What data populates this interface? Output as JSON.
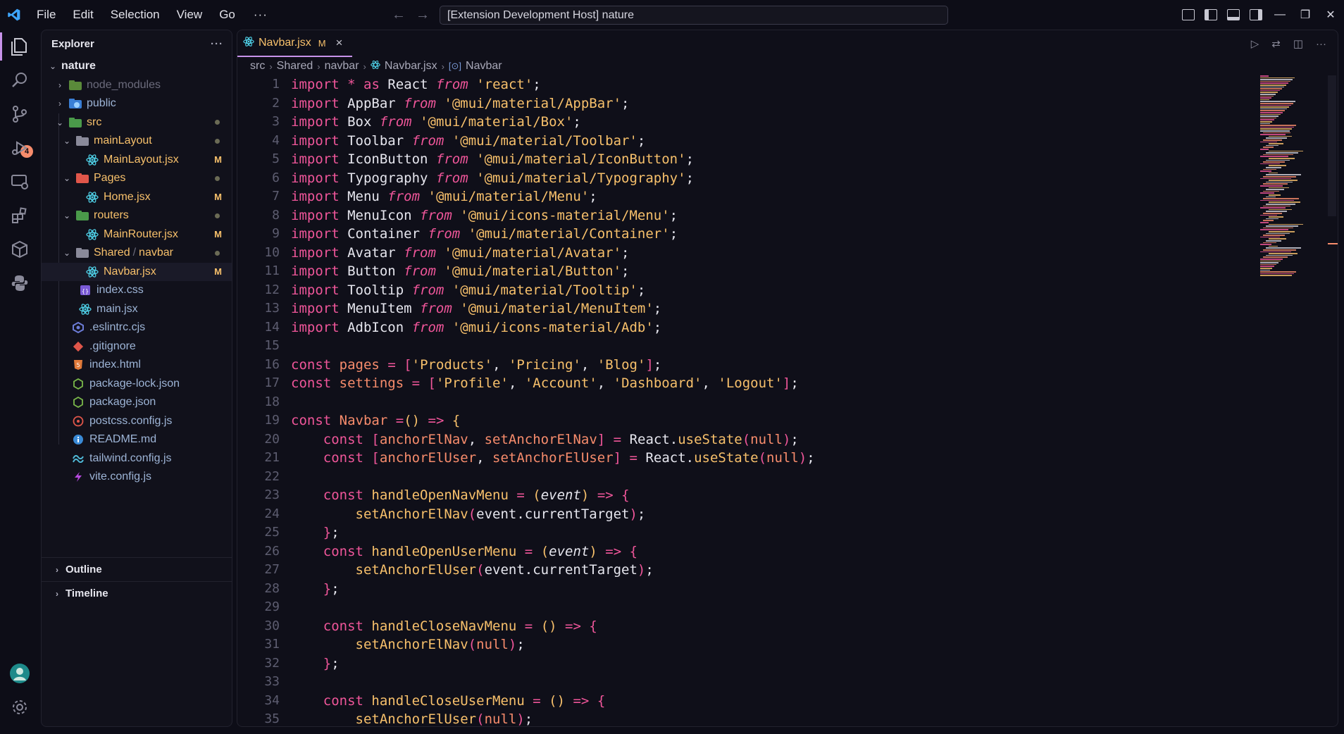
{
  "titlebar": {
    "menus": [
      "File",
      "Edit",
      "Selection",
      "View",
      "Go"
    ],
    "more": "···",
    "command_center": "[Extension Development Host] nature"
  },
  "activity": {
    "source_control_badge": "4"
  },
  "explorer": {
    "title": "Explorer",
    "more": "···",
    "root": "nature",
    "items": [
      {
        "label": "node_modules",
        "decoration": ""
      },
      {
        "label": "public",
        "decoration": ""
      },
      {
        "label": "src",
        "decoration": ""
      },
      {
        "label": "mainLayout",
        "decoration": ""
      },
      {
        "label": "MainLayout.jsx",
        "decoration": "M"
      },
      {
        "label": "Pages",
        "decoration": ""
      },
      {
        "label": "Home.jsx",
        "decoration": "M"
      },
      {
        "label": "routers",
        "decoration": ""
      },
      {
        "label": "MainRouter.jsx",
        "decoration": "M"
      },
      {
        "label": "Shared",
        "label2": "navbar",
        "separator": "/",
        "decoration": ""
      },
      {
        "label": "Navbar.jsx",
        "decoration": "M"
      },
      {
        "label": "index.css",
        "decoration": ""
      },
      {
        "label": "main.jsx",
        "decoration": ""
      },
      {
        "label": ".eslintrc.cjs",
        "decoration": ""
      },
      {
        "label": ".gitignore",
        "decoration": ""
      },
      {
        "label": "index.html",
        "decoration": ""
      },
      {
        "label": "package-lock.json",
        "decoration": ""
      },
      {
        "label": "package.json",
        "decoration": ""
      },
      {
        "label": "postcss.config.js",
        "decoration": ""
      },
      {
        "label": "README.md",
        "decoration": ""
      },
      {
        "label": "tailwind.config.js",
        "decoration": ""
      },
      {
        "label": "vite.config.js",
        "decoration": ""
      }
    ],
    "outline": "Outline",
    "timeline": "Timeline"
  },
  "editor": {
    "tab": {
      "label": "Navbar.jsx",
      "status": "M",
      "close": "×"
    },
    "breadcrumbs": [
      "src",
      "Shared",
      "navbar",
      "Navbar.jsx",
      "Navbar"
    ],
    "lines": [
      "1",
      "2",
      "3",
      "4",
      "5",
      "6",
      "7",
      "8",
      "9",
      "10",
      "11",
      "12",
      "13",
      "14",
      "15",
      "16",
      "17",
      "18",
      "19",
      "20",
      "21",
      "22",
      "23",
      "24",
      "25",
      "26",
      "27",
      "28",
      "29",
      "30",
      "31",
      "32",
      "33",
      "34",
      "35"
    ]
  },
  "colors": {
    "keyword": "#f0569a",
    "string": "#f7c06b",
    "variable": "#f78c6c",
    "accent": "#c792ea",
    "background": "#0d0d17"
  }
}
